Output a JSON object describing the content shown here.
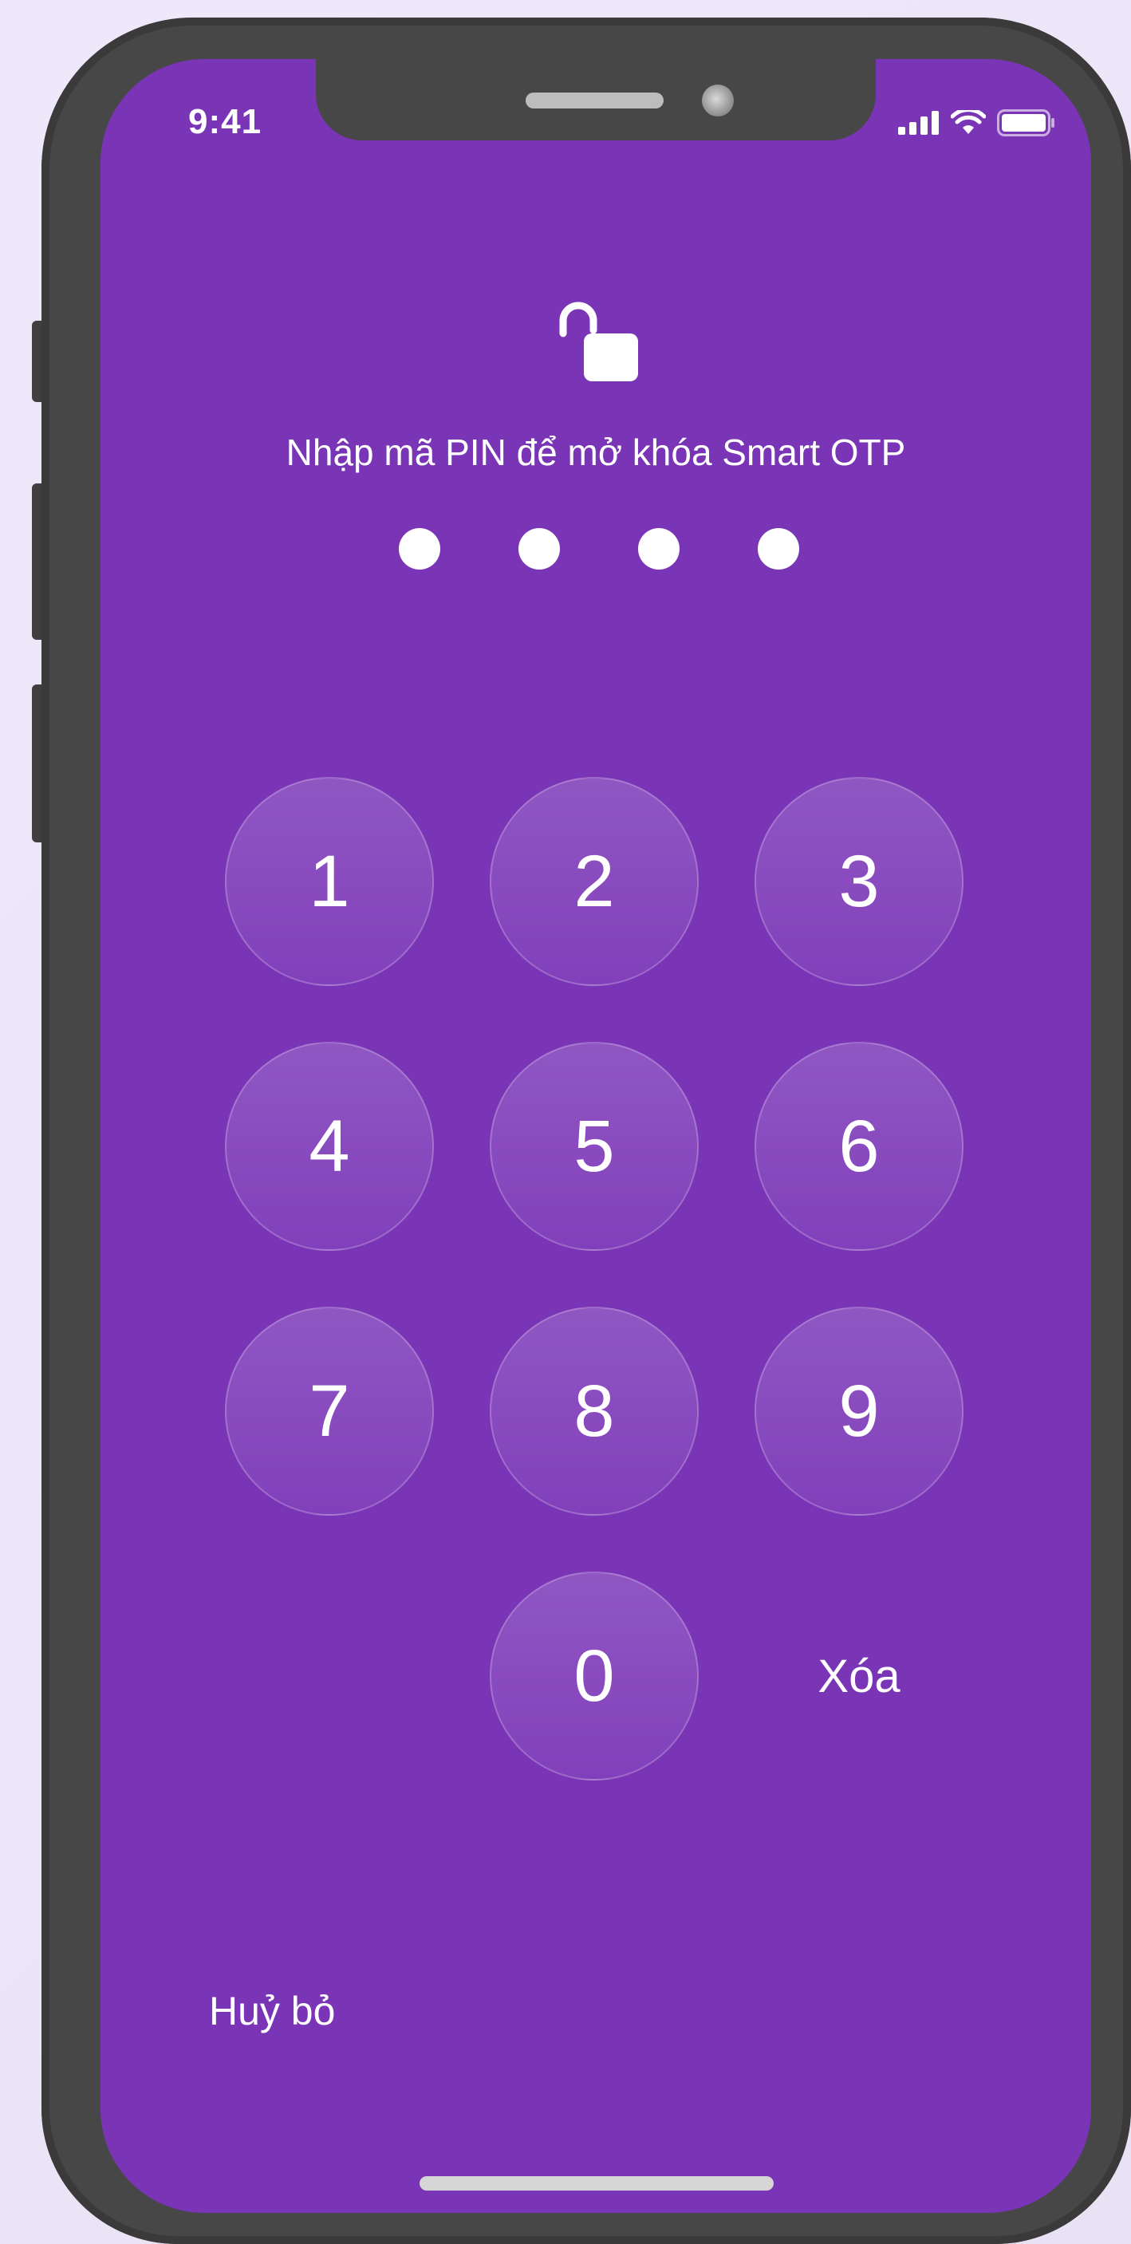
{
  "status_bar": {
    "time": "9:41",
    "icons": [
      "signal-icon",
      "wifi-icon",
      "battery-icon"
    ]
  },
  "lock": {
    "icon": "unlocked-padlock-icon"
  },
  "prompt": "Nhập mã PIN để mở khóa Smart OTP",
  "pin": {
    "length": 4,
    "filled": 4
  },
  "keypad": {
    "keys": [
      "1",
      "2",
      "3",
      "4",
      "5",
      "6",
      "7",
      "8",
      "9",
      "0"
    ],
    "delete_label": "Xóa"
  },
  "cancel_label": "Huỷ bỏ",
  "colors": {
    "screen_background": "#7a35b7",
    "device_frame": "#474747",
    "text": "#ffffff"
  }
}
